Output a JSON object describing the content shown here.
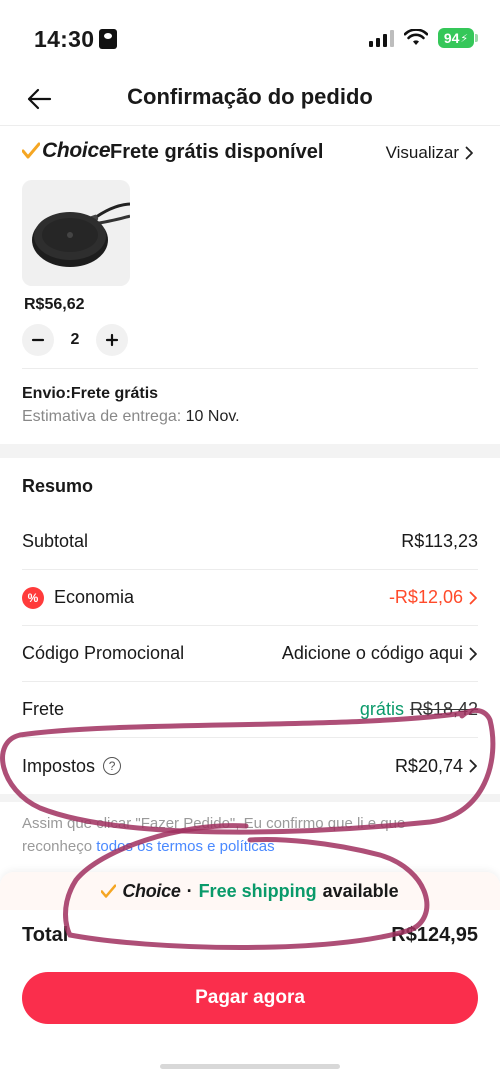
{
  "status": {
    "time": "14:30",
    "battery": "94"
  },
  "nav": {
    "title": "Confirmação do pedido"
  },
  "choice": {
    "brand": "Choice",
    "free_label": "Frete grátis disponível",
    "view_label": "Visualizar"
  },
  "product": {
    "price": "R$56,62",
    "quantity": "2"
  },
  "shipping": {
    "title": "Envio:Frete grátis",
    "estimate_label": "Estimativa de entrega:",
    "estimate_value": "10 Nov."
  },
  "summary": {
    "title": "Resumo",
    "subtotal_label": "Subtotal",
    "subtotal_value": "R$113,23",
    "economy_label": "Economia",
    "economy_value": "-R$12,06",
    "promo_label": "Código Promocional",
    "promo_value": "Adicione o código aqui",
    "shipping_label": "Frete",
    "shipping_free": "grátis",
    "shipping_old": "R$18,42",
    "taxes_label": "Impostos",
    "taxes_value": "R$20,74"
  },
  "legal": {
    "text": "Assim que clicar \"Fazer Pedido\", Eu confirmo que li e que reconheço",
    "link": "todos os termos e políticas"
  },
  "bottom": {
    "choice_brand": "Choice",
    "separator": "·",
    "free_shipping": "Free shipping",
    "available": "available",
    "total_label": "Total",
    "total_value": "R$124,95",
    "pay_label": "Pagar agora"
  },
  "colors": {
    "accent": "#fa2e4c",
    "green": "#0a9a6a",
    "red": "#ff4a2a",
    "annotation": "#a0305f"
  }
}
